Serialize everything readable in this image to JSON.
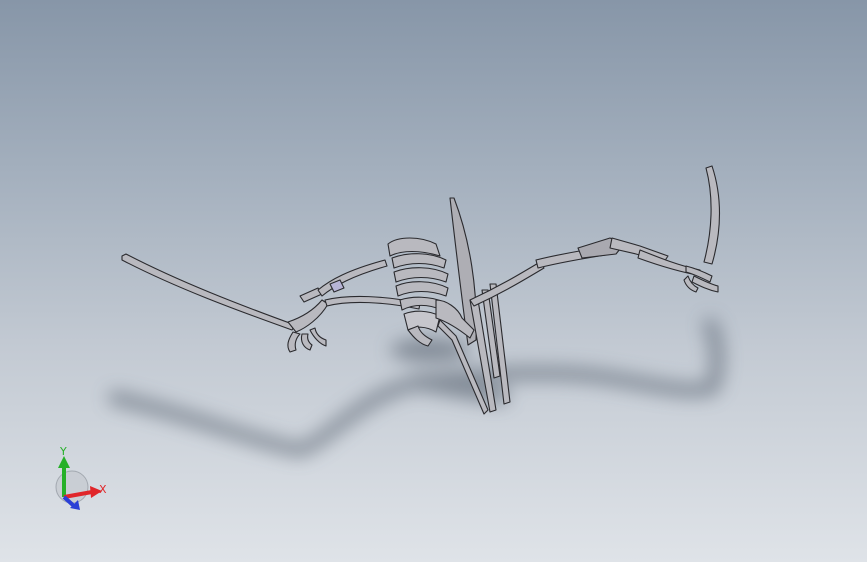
{
  "viewport": {
    "background_top": "#8796a8",
    "background_bottom": "#dfe3e8"
  },
  "model": {
    "name_icon": "pterosaur-skeleton-3d-model",
    "part_fill": "#b9b9bf",
    "part_stroke": "#2a2a2e",
    "shadow": "#4d5866"
  },
  "triad": {
    "x_label": "X",
    "y_label": "Y",
    "x_color": "#e0262a",
    "y_color": "#26b028",
    "z_color": "#2a3fd6"
  }
}
